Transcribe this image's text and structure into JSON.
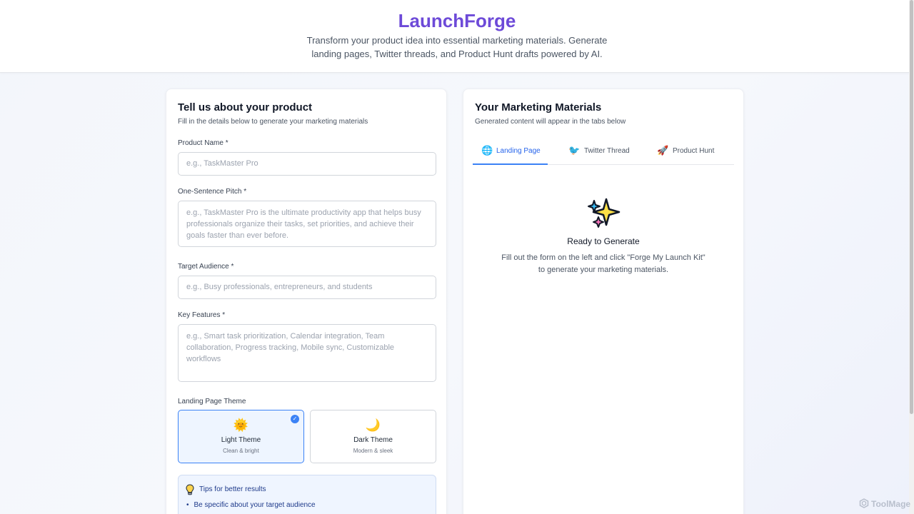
{
  "header": {
    "title": "LaunchForge",
    "subtitle": "Transform your product idea into essential marketing materials. Generate landing pages, Twitter threads, and Product Hunt drafts powered by AI."
  },
  "form": {
    "title": "Tell us about your product",
    "subtitle": "Fill in the details below to generate your marketing materials",
    "product_name": {
      "label": "Product Name *",
      "placeholder": "e.g., TaskMaster Pro",
      "value": ""
    },
    "pitch": {
      "label": "One-Sentence Pitch *",
      "placeholder": "e.g., TaskMaster Pro is the ultimate productivity app that helps busy professionals organize their tasks, set priorities, and achieve their goals faster than ever before.",
      "value": ""
    },
    "audience": {
      "label": "Target Audience *",
      "placeholder": "e.g., Busy professionals, entrepreneurs, and students",
      "value": ""
    },
    "features": {
      "label": "Key Features *",
      "placeholder": "e.g., Smart task prioritization, Calendar integration, Team collaboration, Progress tracking, Mobile sync, Customizable workflows",
      "value": ""
    },
    "theme": {
      "label": "Landing Page Theme",
      "selected": "light",
      "options": [
        {
          "id": "light",
          "icon": "sun-icon",
          "glyph": "🌞",
          "name": "Light Theme",
          "desc": "Clean & bright"
        },
        {
          "id": "dark",
          "icon": "moon-icon",
          "glyph": "🌙",
          "name": "Dark Theme",
          "desc": "Modern & sleek"
        }
      ]
    },
    "tips": {
      "icon": "lightbulb-icon",
      "title": "Tips for better results",
      "items": [
        "Be specific about your target audience"
      ]
    }
  },
  "output": {
    "title": "Your Marketing Materials",
    "subtitle": "Generated content will appear in the tabs below",
    "tabs": [
      {
        "label": "Landing Page",
        "icon": "globe-icon",
        "glyph": "🌐",
        "active": true
      },
      {
        "label": "Twitter Thread",
        "icon": "bird-icon",
        "glyph": "🐦",
        "active": false
      },
      {
        "label": "Product Hunt",
        "icon": "rocket-icon",
        "glyph": "🚀",
        "active": false
      }
    ],
    "empty": {
      "icon": "sparkles-icon",
      "title": "Ready to Generate",
      "description": "Fill out the form on the left and click \"Forge My Launch Kit\" to generate your marketing materials."
    }
  },
  "watermark": {
    "text": "ToolMage"
  },
  "colors": {
    "brand": "#6d4ad8",
    "accent": "#3b82f6",
    "tips_bg": "#eff5ff"
  }
}
